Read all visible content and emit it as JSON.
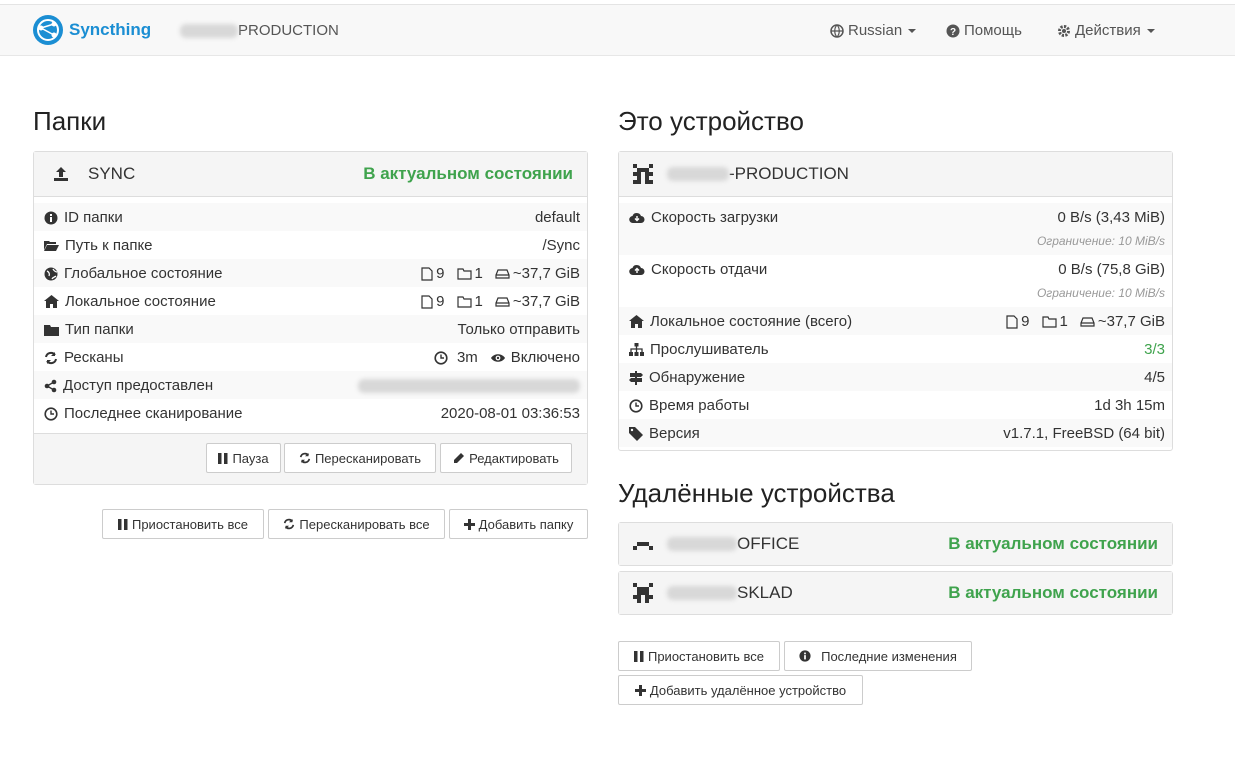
{
  "navbar": {
    "brand": "Syncthing",
    "device_name_suffix": "PRODUCTION",
    "language_label": "Russian",
    "help_label": "Помощь",
    "actions_label": "Действия"
  },
  "folders": {
    "heading": "Папки",
    "folder": {
      "name": "SYNC",
      "status": "В актуальном состоянии",
      "rows": {
        "id_label": "ID папки",
        "id_value": "default",
        "path_label": "Путь к папке",
        "path_value": "/Sync",
        "global_label": "Глобальное состояние",
        "global_files": "9",
        "global_dirs": "1",
        "global_size": "~37,7 GiB",
        "local_label": "Локальное состояние",
        "local_files": "9",
        "local_dirs": "1",
        "local_size": "~37,7 GiB",
        "type_label": "Тип папки",
        "type_value": "Только отправить",
        "rescan_label": "Ресканы",
        "rescan_interval": "3m",
        "rescan_watch": "Включено",
        "shared_label": "Доступ предоставлен",
        "last_scan_label": "Последнее сканирование",
        "last_scan_value": "2020-08-01 03:36:53"
      },
      "buttons": {
        "pause": "Пауза",
        "rescan": "Пересканировать",
        "edit": "Редактировать"
      }
    },
    "buttons": {
      "pause_all": "Приостановить все",
      "rescan_all": "Пересканировать все",
      "add_folder": "Добавить папку"
    }
  },
  "this_device": {
    "heading": "Это устройство",
    "name_suffix": "-PRODUCTION",
    "rows": {
      "download_label": "Скорость загрузки",
      "download_value": "0 B/s (3,43 MiB)",
      "download_limit": "Ограничение: 10 MiB/s",
      "upload_label": "Скорость отдачи",
      "upload_value": "0 B/s (75,8 GiB)",
      "upload_limit": "Ограничение: 10 MiB/s",
      "local_label": "Локальное состояние (всего)",
      "local_files": "9",
      "local_dirs": "1",
      "local_size": "~37,7 GiB",
      "listeners_label": "Прослушиватель",
      "listeners_value": "3/3",
      "discovery_label": "Обнаружение",
      "discovery_value": "4/5",
      "uptime_label": "Время работы",
      "uptime_value": "1d 3h 15m",
      "version_label": "Версия",
      "version_value": "v1.7.1, FreeBSD (64 bit)"
    }
  },
  "remote_devices": {
    "heading": "Удалённые устройства",
    "devices": [
      {
        "name_suffix": "OFFICE",
        "status": "В актуальном состоянии"
      },
      {
        "name_suffix": "SKLAD",
        "status": "В актуальном состоянии"
      }
    ],
    "buttons": {
      "pause_all": "Приостановить все",
      "recent_changes": "Последние изменения",
      "add_device": "Добавить удалённое устройство"
    }
  },
  "colors": {
    "brand": "#1b8ed3",
    "success": "#3fa34d"
  }
}
